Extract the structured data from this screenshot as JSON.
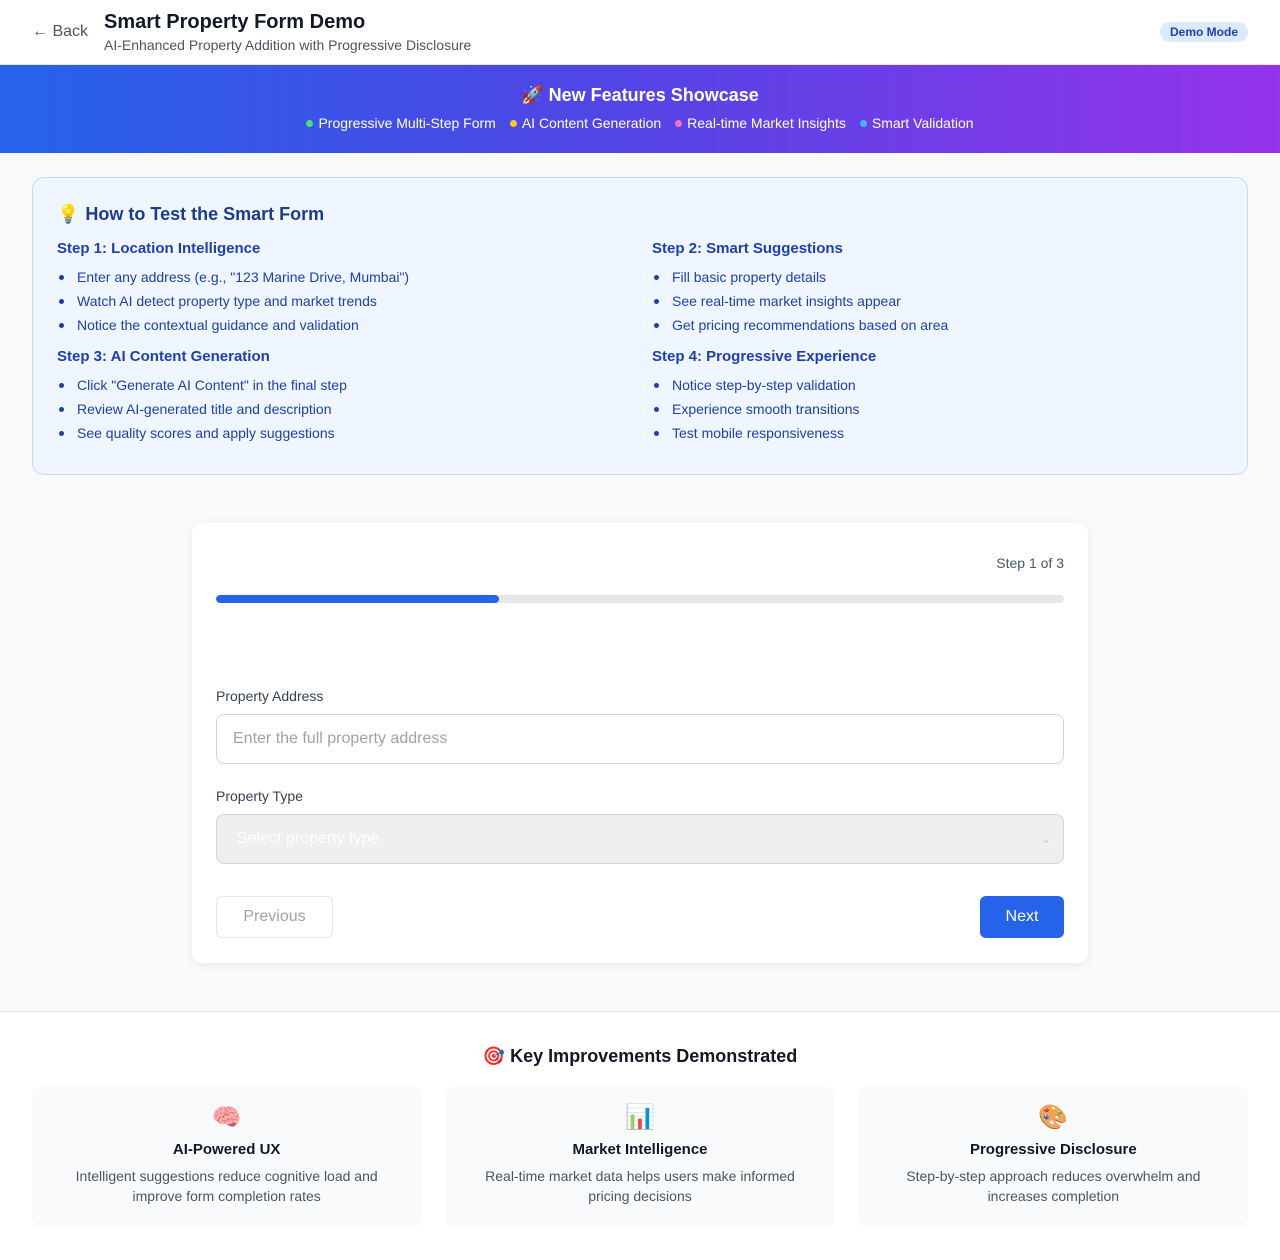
{
  "header": {
    "back_label": "← Back",
    "title": "Smart Property Form Demo",
    "subtitle": "AI-Enhanced Property Addition with Progressive Disclosure",
    "badge": "Demo Mode"
  },
  "banner": {
    "title": "🚀 New Features Showcase",
    "features": [
      {
        "label": "Progressive Multi-Step Form",
        "color": "#4ade80"
      },
      {
        "label": "AI Content Generation",
        "color": "#facc15"
      },
      {
        "label": "Real-time Market Insights",
        "color": "#f472b6"
      },
      {
        "label": "Smart Validation",
        "color": "#38bdf8"
      }
    ]
  },
  "howto": {
    "icon": "💡",
    "title": "How to Test the Smart Form",
    "steps": [
      {
        "title": "Step 1: Location Intelligence",
        "items": [
          "Enter any address (e.g., \"123 Marine Drive, Mumbai\")",
          "Watch AI detect property type and market trends",
          "Notice the contextual guidance and validation"
        ]
      },
      {
        "title": "Step 2: Smart Suggestions",
        "items": [
          "Fill basic property details",
          "See real-time market insights appear",
          "Get pricing recommendations based on area"
        ]
      },
      {
        "title": "Step 3: AI Content Generation",
        "items": [
          "Click \"Generate AI Content\" in the final step",
          "Review AI-generated title and description",
          "See quality scores and apply suggestions"
        ]
      },
      {
        "title": "Step 4: Progressive Experience",
        "items": [
          "Notice step-by-step validation",
          "Experience smooth transitions",
          "Test mobile responsiveness"
        ]
      }
    ]
  },
  "form": {
    "step_indicator": "Step 1 of 3",
    "progress_fraction": 0.3333,
    "address_label": "Property Address",
    "address_placeholder": "Enter the full property address",
    "address_value": "",
    "type_label": "Property Type",
    "type_selected": "Select property type",
    "prev_label": "Previous",
    "next_label": "Next"
  },
  "improvements": {
    "title": "🎯 Key Improvements Demonstrated",
    "cards": [
      {
        "icon": "🧠",
        "title": "AI-Powered UX",
        "desc": "Intelligent suggestions reduce cognitive load and improve form completion rates"
      },
      {
        "icon": "📊",
        "title": "Market Intelligence",
        "desc": "Real-time market data helps users make informed pricing decisions"
      },
      {
        "icon": "🎨",
        "title": "Progressive Disclosure",
        "desc": "Step-by-step approach reduces overwhelm and increases completion"
      }
    ]
  }
}
